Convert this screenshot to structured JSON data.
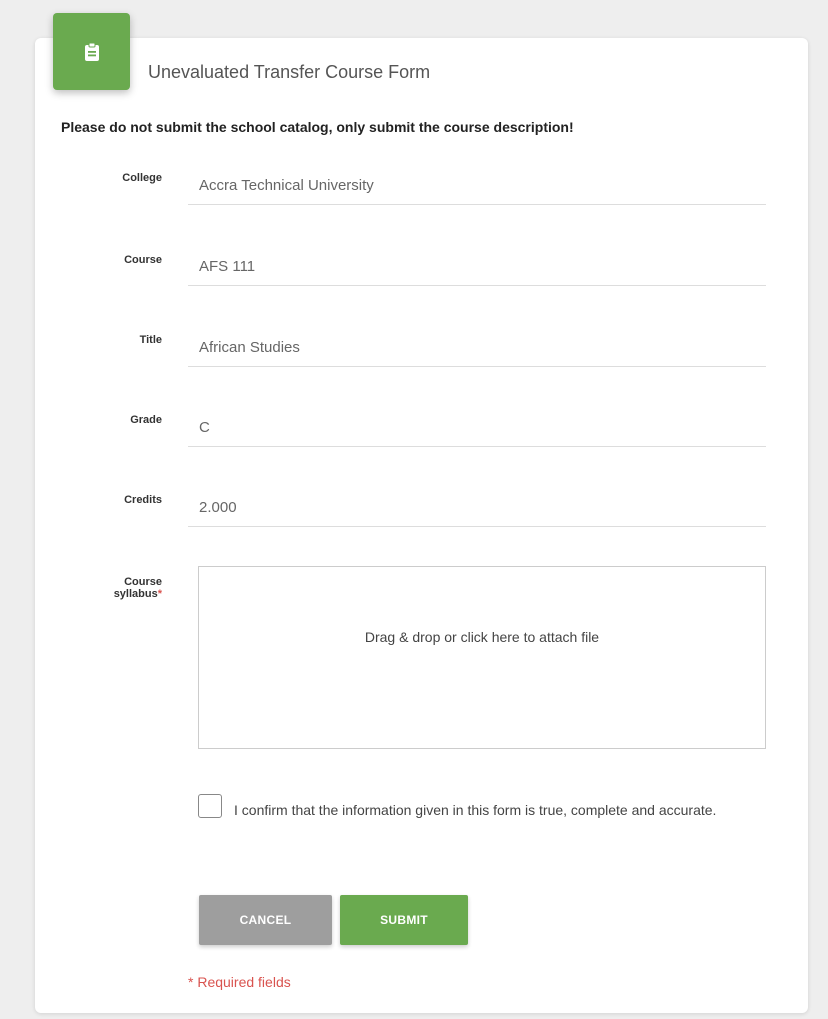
{
  "form": {
    "title": "Unevaluated Transfer Course Form",
    "icon": "clipboard-icon",
    "notice": "Please do not submit the school catalog, only submit the course description!"
  },
  "fields": {
    "college": {
      "label": "College",
      "value": "Accra Technical University"
    },
    "course": {
      "label": "Course",
      "value": "AFS 111"
    },
    "title": {
      "label": "Title",
      "value": "African Studies"
    },
    "grade": {
      "label": "Grade",
      "value": "C"
    },
    "credits": {
      "label": "Credits",
      "value": "2.000"
    },
    "syllabus": {
      "label_line1": "Course",
      "label_line2": "syllabus",
      "required_mark": "*",
      "dropzone_text": "Drag & drop or click here to attach file"
    }
  },
  "confirm": {
    "text": "I confirm that the information given in this form is true, complete and accurate.",
    "checked": false
  },
  "buttons": {
    "cancel_label": "CANCEL",
    "submit_label": "SUBMIT"
  },
  "required_note": "* Required fields",
  "colors": {
    "accent": "#6aaa4f",
    "cancel": "#9e9e9e",
    "required": "#d9534f"
  }
}
